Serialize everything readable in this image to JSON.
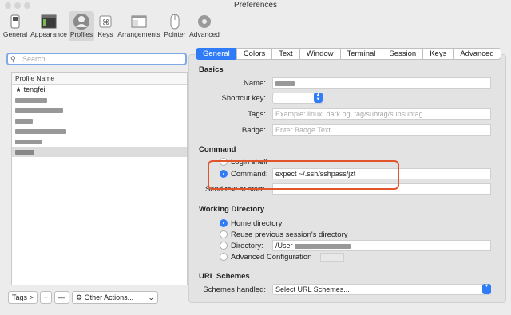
{
  "window": {
    "title": "Preferences"
  },
  "toolbar": {
    "items": [
      {
        "label": "General"
      },
      {
        "label": "Appearance"
      },
      {
        "label": "Profiles"
      },
      {
        "label": "Keys"
      },
      {
        "label": "Arrangements"
      },
      {
        "label": "Pointer"
      },
      {
        "label": "Advanced"
      }
    ],
    "selected": "Profiles"
  },
  "profiles": {
    "search_placeholder": "Search",
    "column_header": "Profile Name",
    "items": [
      {
        "label": "★ tengfei",
        "selected": false
      }
    ],
    "bottom": {
      "tags_label": "Tags >",
      "add_label": "+",
      "remove_label": "—",
      "other_actions_label": "Other Actions..."
    }
  },
  "tabs": [
    "General",
    "Colors",
    "Text",
    "Window",
    "Terminal",
    "Session",
    "Keys",
    "Advanced"
  ],
  "active_tab": "General",
  "basics": {
    "heading": "Basics",
    "name_label": "Name:",
    "shortcut_label": "Shortcut key:",
    "tags_label": "Tags:",
    "tags_placeholder": "Example: linux, dark bg, tag/subtag/subsubtag",
    "badge_label": "Badge:",
    "badge_placeholder": "Enter Badge Text"
  },
  "command": {
    "heading": "Command",
    "login_shell_label": "Login shell",
    "command_label": "Command:",
    "command_value": "expect ~/.ssh/sshpass/jzt",
    "send_text_label": "Send text at start:"
  },
  "working_directory": {
    "heading": "Working Directory",
    "home_label": "Home directory",
    "reuse_label": "Reuse previous session's directory",
    "directory_label": "Directory:",
    "directory_value": "/User",
    "advanced_label": "Advanced Configuration"
  },
  "url_schemes": {
    "heading": "URL Schemes",
    "handled_label": "Schemes handled:",
    "select_value": "Select URL Schemes..."
  },
  "colors": {
    "accent": "#2f7cf6",
    "highlight": "#e2542b"
  }
}
